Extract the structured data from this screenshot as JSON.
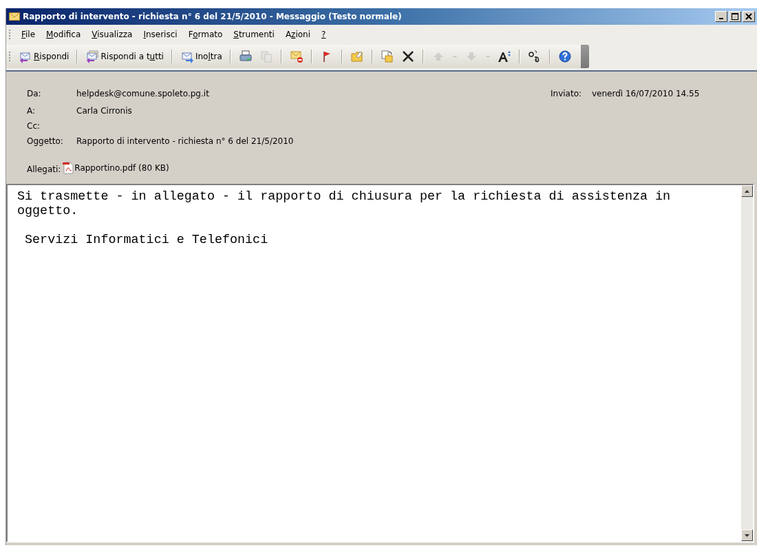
{
  "window": {
    "title": "Rapporto di intervento - richiesta n° 6 del 21/5/2010 - Messaggio (Testo normale)",
    "controls": [
      {
        "kind": "minimize"
      },
      {
        "kind": "maximize"
      },
      {
        "kind": "close"
      }
    ]
  },
  "menu": [
    {
      "key": "F",
      "post": "ile"
    },
    {
      "key": "M",
      "post": "odifica"
    },
    {
      "key": "V",
      "post": "isualizza"
    },
    {
      "key": "I",
      "post": "nserisci"
    },
    {
      "pre": "F",
      "key": "o",
      "post": "rmato"
    },
    {
      "key": "S",
      "post": "trumenti"
    },
    {
      "pre": "A",
      "key": "z",
      "post": "ioni"
    },
    {
      "key": "?"
    }
  ],
  "toolbar": [
    {
      "kind": "reply",
      "key": "R",
      "post": "ispondi",
      "disabled": false
    },
    {
      "kind": "separator"
    },
    {
      "kind": "reply-all",
      "pre": "Rispondi a t",
      "key": "u",
      "post": "tti",
      "disabled": false
    },
    {
      "kind": "separator"
    },
    {
      "kind": "forward",
      "pre": "Ino",
      "key": "l",
      "post": "tra",
      "disabled": false
    },
    {
      "kind": "separator"
    },
    {
      "kind": "print",
      "disabled": false
    },
    {
      "kind": "copy",
      "disabled": true
    },
    {
      "kind": "separator"
    },
    {
      "kind": "unread",
      "disabled": false
    },
    {
      "kind": "separator"
    },
    {
      "kind": "flag",
      "disabled": false
    },
    {
      "kind": "separator"
    },
    {
      "kind": "folder",
      "disabled": false
    },
    {
      "kind": "separator"
    },
    {
      "kind": "move",
      "disabled": false
    },
    {
      "kind": "delete",
      "disabled": false
    },
    {
      "kind": "separator"
    },
    {
      "kind": "up",
      "disabled": true
    },
    {
      "kind": "dropdown",
      "disabled": true
    },
    {
      "kind": "down",
      "disabled": true
    },
    {
      "kind": "dropdown",
      "disabled": true
    },
    {
      "kind": "font",
      "disabled": false
    },
    {
      "kind": "separator"
    },
    {
      "kind": "encoding",
      "disabled": false
    },
    {
      "kind": "separator"
    },
    {
      "kind": "help",
      "disabled": false
    }
  ],
  "header": {
    "from": {
      "label": "Da:",
      "value": "helpdesk@comune.spoleto.pg.it"
    },
    "sent": {
      "label": "Inviato:",
      "value": "venerdì 16/07/2010 14.55"
    },
    "to": {
      "label": "A:",
      "value": "Carla Cirronis"
    },
    "cc": {
      "label": "Cc:"
    },
    "subject": {
      "label": "Oggetto:",
      "value": "Rapporto di intervento - richiesta n° 6 del 21/5/2010"
    },
    "attachments": {
      "label": "Allegati:",
      "files": [
        {
          "name": "Rapportino.pdf (80 KB)"
        }
      ]
    }
  },
  "body": {
    "paragraphs": [
      [
        "Si trasmette - in allegato - il rapporto di chiusura per la richiesta di assistenza in",
        "oggetto."
      ],
      [
        " Servizi Informatici e Telefonici"
      ]
    ]
  }
}
